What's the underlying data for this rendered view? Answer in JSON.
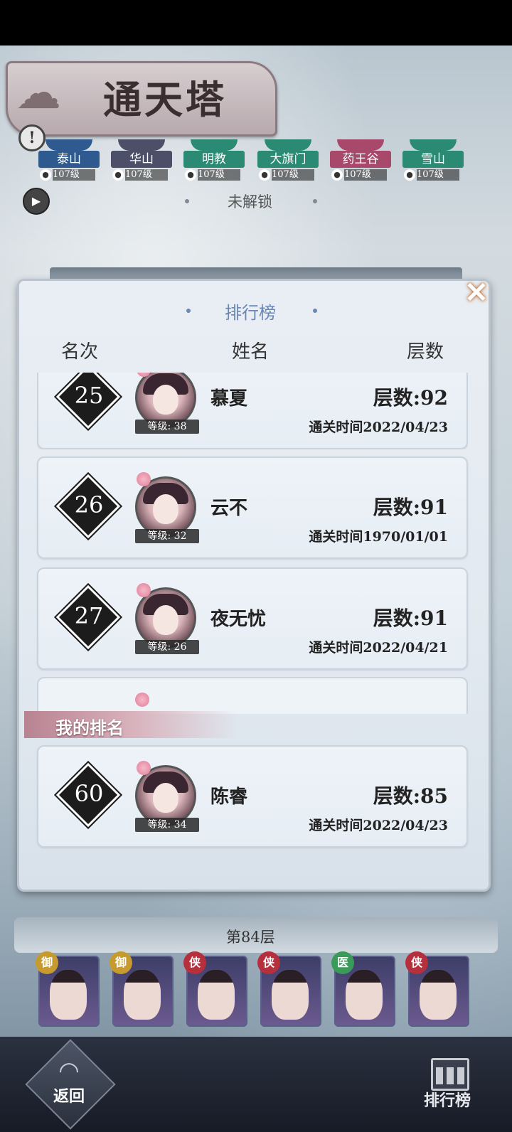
{
  "title": "通天塔",
  "sects": [
    {
      "name": "泰山",
      "level": "107级",
      "color": "#2f5a8f",
      "icon": "water-icon"
    },
    {
      "name": "华山",
      "level": "107级",
      "color": "#4b4f68",
      "icon": "mountain-icon"
    },
    {
      "name": "明教",
      "level": "107级",
      "color": "#2b8a73",
      "icon": "leaf-icon"
    },
    {
      "name": "大旗门",
      "level": "107级",
      "color": "#2b8a73",
      "icon": "leaf-icon"
    },
    {
      "name": "药王谷",
      "level": "107级",
      "color": "#a8486a",
      "icon": "fire-icon"
    },
    {
      "name": "雪山",
      "level": "107级",
      "color": "#2b8a73",
      "icon": "leaf-icon"
    }
  ],
  "unlock_label": "未解锁",
  "leaderboard": {
    "title": "排行榜",
    "headers": {
      "rank": "名次",
      "name": "姓名",
      "floors": "层数"
    },
    "rows": [
      {
        "rank": "25",
        "name": "慕夏",
        "level": "等级: 38",
        "floors": "层数:92",
        "time": "通关时间2022/04/23"
      },
      {
        "rank": "26",
        "name": "云不",
        "level": "等级: 32",
        "floors": "层数:91",
        "time": "通关时间1970/01/01"
      },
      {
        "rank": "27",
        "name": "夜无忧",
        "level": "等级: 26",
        "floors": "层数:91",
        "time": "通关时间2022/04/21"
      }
    ],
    "my_rank_label": "我的排名",
    "my_rank": {
      "rank": "60",
      "name": "陈睿",
      "level": "等级: 34",
      "floors": "层数:85",
      "time": "通关时间2022/04/23"
    }
  },
  "floor_label": "第84层",
  "heroes": [
    {
      "tag": "御",
      "tag_color": "#c79a2e"
    },
    {
      "tag": "御",
      "tag_color": "#c79a2e"
    },
    {
      "tag": "侠",
      "tag_color": "#b5303c"
    },
    {
      "tag": "侠",
      "tag_color": "#b5303c"
    },
    {
      "tag": "医",
      "tag_color": "#3a9a5a"
    },
    {
      "tag": "侠",
      "tag_color": "#b5303c"
    }
  ],
  "bottom": {
    "back_label": "返回",
    "rank_label": "排行榜"
  }
}
